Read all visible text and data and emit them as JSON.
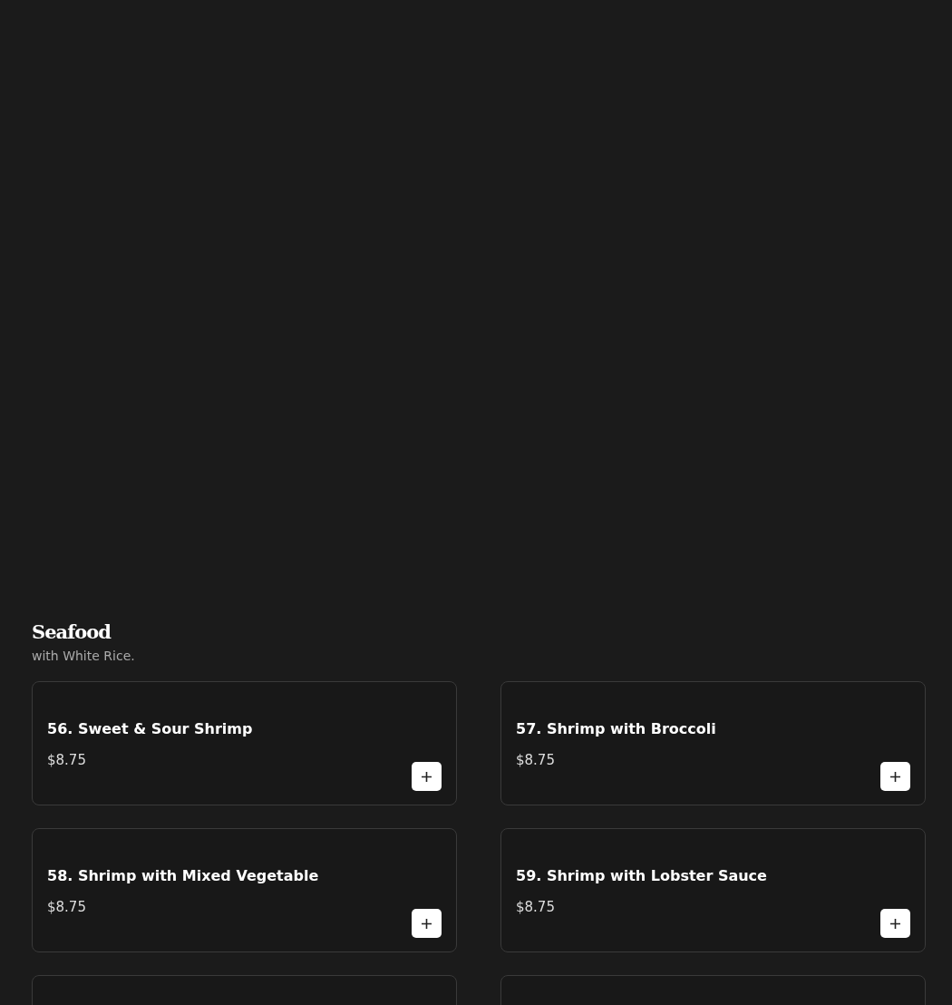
{
  "section": {
    "title": "Seafood",
    "subtitle": "with White Rice."
  },
  "items": [
    {
      "kind": "dish",
      "name": "56. Sweet & Sour Shrimp",
      "price": "$8.75"
    },
    {
      "kind": "dish",
      "name": "57. Shrimp with Broccoli",
      "price": "$8.75"
    },
    {
      "kind": "dish",
      "name": "58. Shrimp with Mixed Vegetable",
      "price": "$8.75"
    },
    {
      "kind": "dish",
      "name": "59. Shrimp with Lobster Sauce",
      "price": "$8.75"
    },
    {
      "kind": "cut"
    },
    {
      "kind": "cut"
    }
  ]
}
